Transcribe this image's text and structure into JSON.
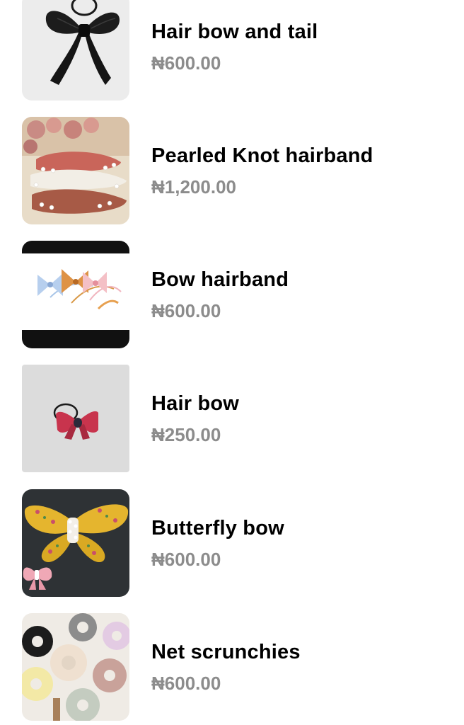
{
  "products": [
    {
      "title": "Hair bow and tail",
      "price": "₦600.00",
      "image_icon": "black-satin-bow-image"
    },
    {
      "title": "Pearled Knot hairband",
      "price": "₦1,200.00",
      "image_icon": "pearled-knot-hairbands-image"
    },
    {
      "title": "Bow hairband",
      "price": "₦600.00",
      "image_icon": "bow-hairbands-image"
    },
    {
      "title": "Hair bow",
      "price": "₦250.00",
      "image_icon": "red-hair-bow-image"
    },
    {
      "title": "Butterfly bow",
      "price": "₦600.00",
      "image_icon": "yellow-butterfly-bow-image"
    },
    {
      "title": "Net scrunchies",
      "price": "₦600.00",
      "image_icon": "net-scrunchies-image"
    }
  ],
  "colors": {
    "background": "#ffffff",
    "title": "#000000",
    "price": "#8c8c8c"
  }
}
